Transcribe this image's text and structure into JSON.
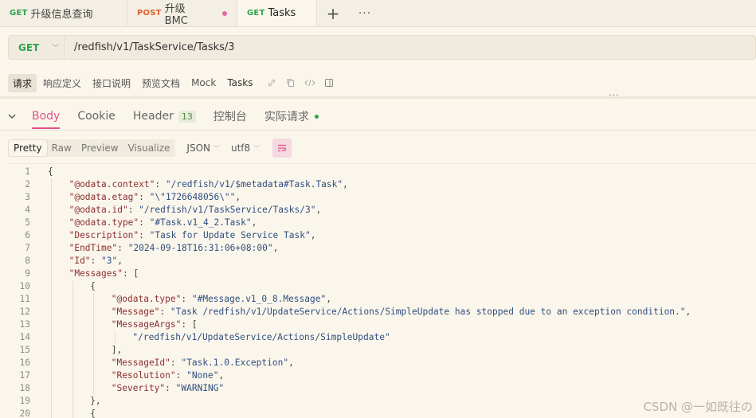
{
  "tabs": [
    {
      "method": "GET",
      "label": "升级信息查询",
      "method_color": "#2da44e",
      "unsaved": false
    },
    {
      "method": "POST",
      "label": "升级BMC",
      "method_color": "#e0622f",
      "unsaved": true
    },
    {
      "method": "GET",
      "label": "Tasks",
      "method_color": "#2da44e",
      "unsaved": true
    }
  ],
  "tab_actions": {
    "add": "+",
    "more": "···"
  },
  "request": {
    "method": "GET",
    "url": "/redfish/v1/TaskService/Tasks/3"
  },
  "subtabs": [
    "请求",
    "响应定义",
    "接口说明",
    "预览文档",
    "Mock"
  ],
  "request_name": "Tasks",
  "response_tabs": {
    "body": "Body",
    "cookie": "Cookie",
    "header": "Header",
    "header_count": "13",
    "console": "控制台",
    "actual_request": "实际请求"
  },
  "format": {
    "modes": [
      "Pretty",
      "Raw",
      "Preview",
      "Visualize"
    ],
    "active": "Pretty",
    "type": "JSON",
    "encoding": "utf8"
  },
  "code_lines": [
    [
      [
        "p",
        "{"
      ]
    ],
    [
      [
        "k",
        "\"@odata.context\""
      ],
      [
        "p",
        ": "
      ],
      [
        "s",
        "\"/redfish/v1/$metadata#Task.Task\""
      ],
      [
        "p",
        ","
      ]
    ],
    [
      [
        "k",
        "\"@odata.etag\""
      ],
      [
        "p",
        ": "
      ],
      [
        "s",
        "\"\\\"1726648056\\\"\""
      ],
      [
        "p",
        ","
      ]
    ],
    [
      [
        "k",
        "\"@odata.id\""
      ],
      [
        "p",
        ": "
      ],
      [
        "s",
        "\"/redfish/v1/TaskService/Tasks/3\""
      ],
      [
        "p",
        ","
      ]
    ],
    [
      [
        "k",
        "\"@odata.type\""
      ],
      [
        "p",
        ": "
      ],
      [
        "s",
        "\"#Task.v1_4_2.Task\""
      ],
      [
        "p",
        ","
      ]
    ],
    [
      [
        "k",
        "\"Description\""
      ],
      [
        "p",
        ": "
      ],
      [
        "s",
        "\"Task for Update Service Task\""
      ],
      [
        "p",
        ","
      ]
    ],
    [
      [
        "k",
        "\"EndTime\""
      ],
      [
        "p",
        ": "
      ],
      [
        "s",
        "\"2024-09-18T16:31:06+08:00\""
      ],
      [
        "p",
        ","
      ]
    ],
    [
      [
        "k",
        "\"Id\""
      ],
      [
        "p",
        ": "
      ],
      [
        "s",
        "\"3\""
      ],
      [
        "p",
        ","
      ]
    ],
    [
      [
        "k",
        "\"Messages\""
      ],
      [
        "p",
        ": ["
      ]
    ],
    [
      [
        "p",
        "{"
      ]
    ],
    [
      [
        "k",
        "\"@odata.type\""
      ],
      [
        "p",
        ": "
      ],
      [
        "s",
        "\"#Message.v1_0_8.Message\""
      ],
      [
        "p",
        ","
      ]
    ],
    [
      [
        "k",
        "\"Message\""
      ],
      [
        "p",
        ": "
      ],
      [
        "s",
        "\"Task /redfish/v1/UpdateService/Actions/SimpleUpdate has stopped due to an exception condition.\""
      ],
      [
        "p",
        ","
      ]
    ],
    [
      [
        "k",
        "\"MessageArgs\""
      ],
      [
        "p",
        ": ["
      ]
    ],
    [
      [
        "s",
        "\"/redfish/v1/UpdateService/Actions/SimpleUpdate\""
      ]
    ],
    [
      [
        "p",
        "],"
      ]
    ],
    [
      [
        "k",
        "\"MessageId\""
      ],
      [
        "p",
        ": "
      ],
      [
        "s",
        "\"Task.1.0.Exception\""
      ],
      [
        "p",
        ","
      ]
    ],
    [
      [
        "k",
        "\"Resolution\""
      ],
      [
        "p",
        ": "
      ],
      [
        "s",
        "\"None\""
      ],
      [
        "p",
        ","
      ]
    ],
    [
      [
        "k",
        "\"Severity\""
      ],
      [
        "p",
        ": "
      ],
      [
        "s",
        "\"WARNING\""
      ]
    ],
    [
      [
        "p",
        "},"
      ]
    ],
    [
      [
        "p",
        "{"
      ]
    ]
  ],
  "code_indents": [
    0,
    1,
    1,
    1,
    1,
    1,
    1,
    1,
    1,
    2,
    3,
    3,
    3,
    4,
    3,
    3,
    3,
    3,
    2,
    2
  ],
  "line_numbers": [
    "1",
    "2",
    "3",
    "4",
    "5",
    "6",
    "7",
    "8",
    "9",
    "10",
    "11",
    "12",
    "13",
    "14",
    "15",
    "16",
    "17",
    "18",
    "19",
    "20"
  ],
  "watermark": "CSDN @一如既往の"
}
